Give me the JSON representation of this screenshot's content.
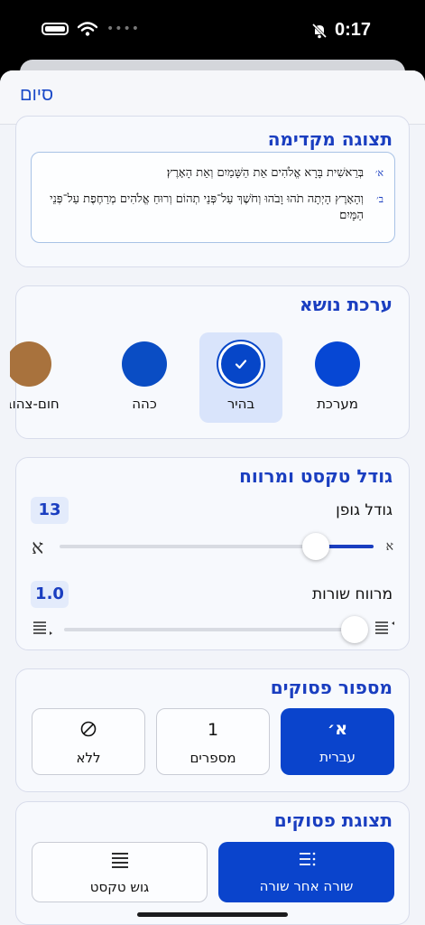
{
  "status": {
    "time": "0:17"
  },
  "nav": {
    "done_label": "סיום"
  },
  "preview": {
    "title": "תצוגה מקדימה",
    "verses": [
      {
        "num": "א׳",
        "text": "בְּרֵאשִׁית בָּרָא אֱלֹהִים אֵת הַשָּׁמַיִם וְאֵת הָאָרֶץ׃"
      },
      {
        "num": "ב׳",
        "text": "וְהָאָרֶץ הָיְתָה תֹהוּ וָבֹהוּ וְחֹשֶׁךְ עַל־פְּנֵי תְהוֹם וְרוּחַ אֱלֹהִים מְרַחֶפֶת עַל־פְּנֵי הַמָּיִם׃"
      }
    ]
  },
  "theme": {
    "title": "ערכת נושא",
    "options": [
      {
        "label": "מערכת",
        "color": "#0647d4",
        "selected": false
      },
      {
        "label": "בהיר",
        "color": "#0646c8",
        "selected": true
      },
      {
        "label": "כהה",
        "color": "#0a4dc4",
        "selected": false
      },
      {
        "label": "חום-צהוב",
        "color": "#a8723d",
        "selected": false
      }
    ]
  },
  "text_size": {
    "title": "גודל טקסט ומרווח",
    "font_size_label": "גודל גופן",
    "font_size_value": "13",
    "font_small_glyph": "א",
    "font_large_glyph": "א",
    "font_slider_fraction": 0.85,
    "line_spacing_label": "מרווח שורות",
    "line_spacing_value": "1.0",
    "line_slider_fraction": 0.0
  },
  "verse_numbers": {
    "title": "מספור פסוקים",
    "options": [
      {
        "top": "א׳",
        "bottom": "עברית",
        "selected": true
      },
      {
        "top": "1",
        "bottom": "מספרים",
        "selected": false
      },
      {
        "top": "",
        "bottom": "ללא",
        "selected": false
      }
    ]
  },
  "verse_display": {
    "title": "תצוגת פסוקים",
    "options": [
      {
        "label": "שורה אחר שורה",
        "icon": "list-numbered-icon",
        "selected": true
      },
      {
        "label": "גוש טקסט",
        "icon": "text-block-icon",
        "selected": false
      }
    ]
  },
  "colors": {
    "accent": "#1a3ec0",
    "primary_button": "#0a44cc"
  }
}
